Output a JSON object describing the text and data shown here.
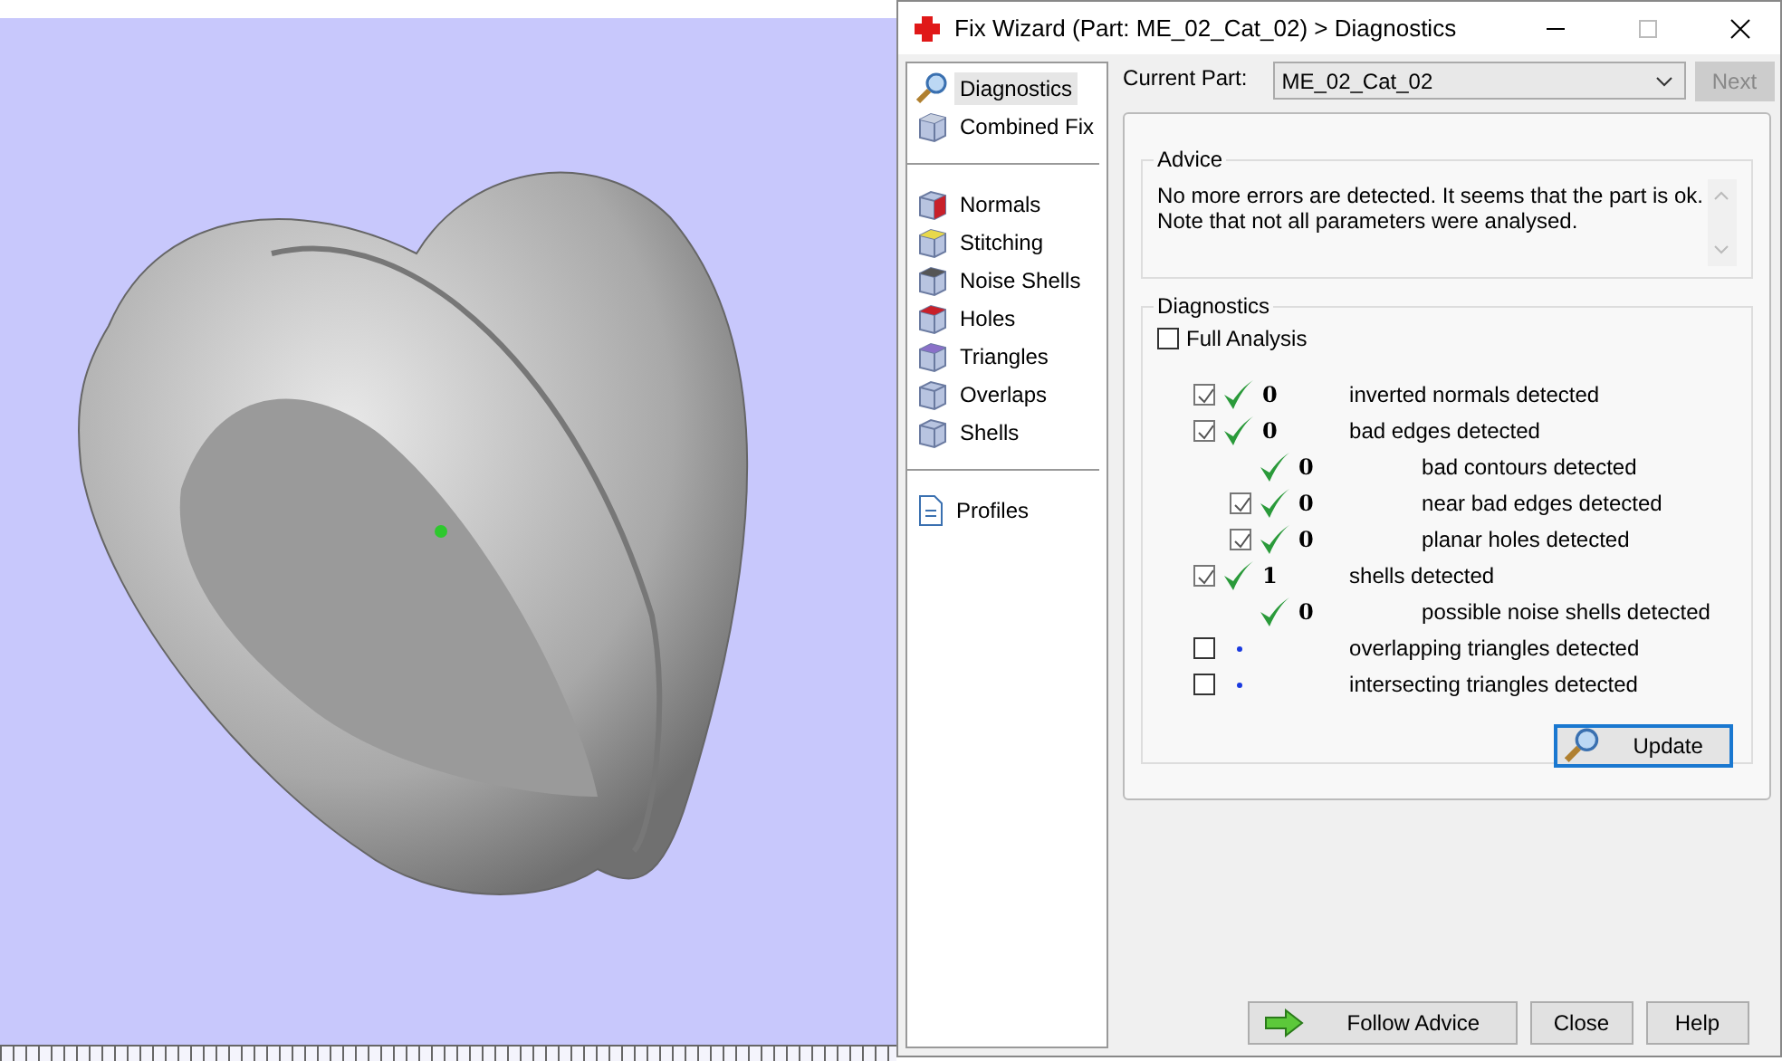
{
  "window": {
    "title": "Fix Wizard (Part: ME_02_Cat_02) > Diagnostics"
  },
  "sidebar": {
    "groups": [
      [
        {
          "label": "Diagnostics",
          "selected": true,
          "kind": "magnifier"
        },
        {
          "label": "Combined Fix",
          "selected": false,
          "kind": "cubes"
        }
      ],
      [
        {
          "label": "Normals",
          "selected": false,
          "kind": "cube-red"
        },
        {
          "label": "Stitching",
          "selected": false,
          "kind": "cube-yellow"
        },
        {
          "label": "Noise Shells",
          "selected": false,
          "kind": "dice"
        },
        {
          "label": "Holes",
          "selected": false,
          "kind": "cube-top"
        },
        {
          "label": "Triangles",
          "selected": false,
          "kind": "triangle"
        },
        {
          "label": "Overlaps",
          "selected": false,
          "kind": "cube"
        },
        {
          "label": "Shells",
          "selected": false,
          "kind": "cube"
        }
      ],
      [
        {
          "label": "Profiles",
          "selected": false,
          "kind": "document"
        }
      ]
    ]
  },
  "current_part": {
    "label": "Current Part:",
    "value": "ME_02_Cat_02",
    "next_button": "Next",
    "next_disabled": true
  },
  "advice": {
    "title": "Advice",
    "lines": [
      "No more errors are detected. It seems that the part is ok.",
      "Note that not all parameters were analysed."
    ]
  },
  "diagnostics": {
    "title": "Diagnostics",
    "full_analysis": {
      "label": "Full Analysis",
      "checked": false
    },
    "rows": [
      {
        "kind": "check",
        "checked": true,
        "passed": true,
        "count": "0",
        "label": "inverted normals detected"
      },
      {
        "kind": "check",
        "checked": true,
        "passed": true,
        "count": "0",
        "label": "bad edges detected",
        "children": [
          {
            "kind": "plain",
            "passed": true,
            "count": "0",
            "label": "bad contours detected"
          },
          {
            "kind": "check",
            "checked": true,
            "passed": true,
            "count": "0",
            "label": "near bad edges detected"
          },
          {
            "kind": "check",
            "checked": true,
            "passed": true,
            "count": "0",
            "label": "planar holes detected"
          }
        ]
      },
      {
        "kind": "check",
        "checked": true,
        "passed": true,
        "count": "1",
        "label": "shells detected",
        "children": [
          {
            "kind": "plain",
            "passed": true,
            "count": "0",
            "label": "possible noise shells detected"
          }
        ]
      },
      {
        "kind": "check",
        "checked": false,
        "passed": false,
        "label": "overlapping triangles detected"
      },
      {
        "kind": "check",
        "checked": false,
        "passed": false,
        "label": "intersecting triangles detected"
      }
    ],
    "update_button": "Update"
  },
  "buttons": [
    {
      "label": "Follow Advice",
      "kind": "arrow"
    },
    {
      "label": "Close",
      "kind": "plain"
    },
    {
      "label": "Help",
      "kind": "plain"
    }
  ]
}
